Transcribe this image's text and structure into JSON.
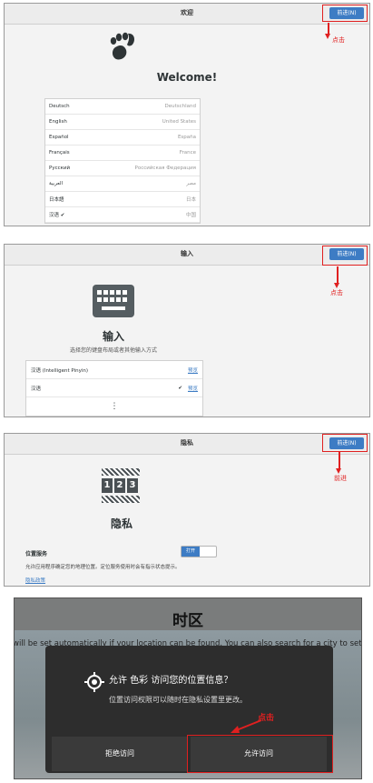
{
  "panel1": {
    "header_title": "欢迎",
    "next_button": "前进(N)",
    "annotation": "点击",
    "welcome": "Welcome!",
    "languages": [
      {
        "name": "Deutsch",
        "native": "Deutschland"
      },
      {
        "name": "English",
        "native": "United States"
      },
      {
        "name": "Español",
        "native": "España"
      },
      {
        "name": "Français",
        "native": "France"
      },
      {
        "name": "Русский",
        "native": "Российская Федерация"
      },
      {
        "name": "العربية",
        "native": "مصر"
      },
      {
        "name": "日本語",
        "native": "日本"
      },
      {
        "name": "汉语",
        "native": "中国",
        "checked": "✔"
      }
    ]
  },
  "panel2": {
    "header_title": "输入",
    "next_button": "前进(N)",
    "annotation": "点击",
    "title": "输入",
    "description": "选择您的键盘布局或者其他输入方式",
    "sources": [
      {
        "name": "汉语 (Intelligent Pinyin)",
        "check": "",
        "preview": "预览"
      },
      {
        "name": "汉语",
        "check": "✔",
        "preview": "预览"
      }
    ],
    "more": "⋮"
  },
  "panel3": {
    "header_title": "隐私",
    "next_button": "前进(N)",
    "annotation": "前进",
    "icon_digits": [
      "1",
      "2",
      "3"
    ],
    "title": "隐私",
    "location_label": "位置服务",
    "toggle_on": "打开",
    "location_desc": "允许应用程序确定您的地理位置。定位服务使用时会有指示状态提示。",
    "privacy_link": "隐私政策"
  },
  "panel4": {
    "title": "时区",
    "bg_text": "will be set automatically if your location can be found. You can also search for a city to set a",
    "dialog_title": "允许 色彩 访问您的位置信息？",
    "dialog_body": "位置访问权限可以随时在隐私设置里更改。",
    "deny_button": "拒绝访问",
    "allow_button": "允许访问",
    "annotation": "点击"
  }
}
